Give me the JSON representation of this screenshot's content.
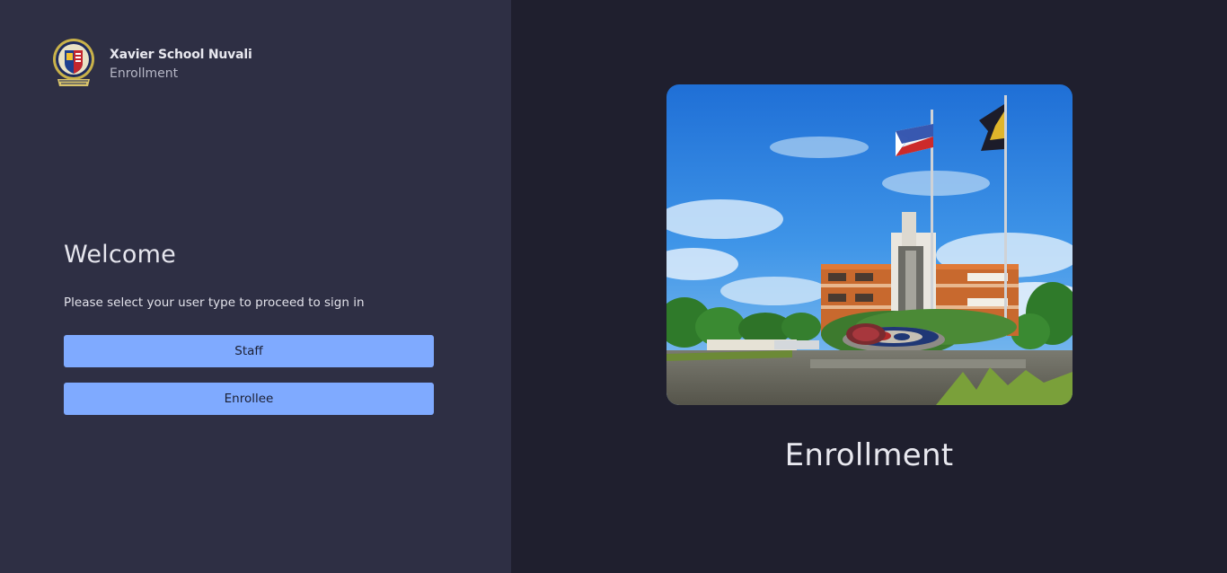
{
  "brand": {
    "name": "Xavier School Nuvali",
    "subtitle": "Enrollment",
    "logo_icon": "school-crest-icon"
  },
  "welcome": {
    "title": "Welcome",
    "instruction": "Please select your user type to proceed to sign in"
  },
  "buttons": {
    "staff_label": "Staff",
    "enrollee_label": "Enrollee"
  },
  "hero": {
    "image_alt": "campus-photo",
    "caption": "Enrollment"
  },
  "colors": {
    "left_panel": "#2e2f44",
    "right_panel": "#1f1f2e",
    "button": "#7faaff",
    "text": "#e8e8ef"
  }
}
